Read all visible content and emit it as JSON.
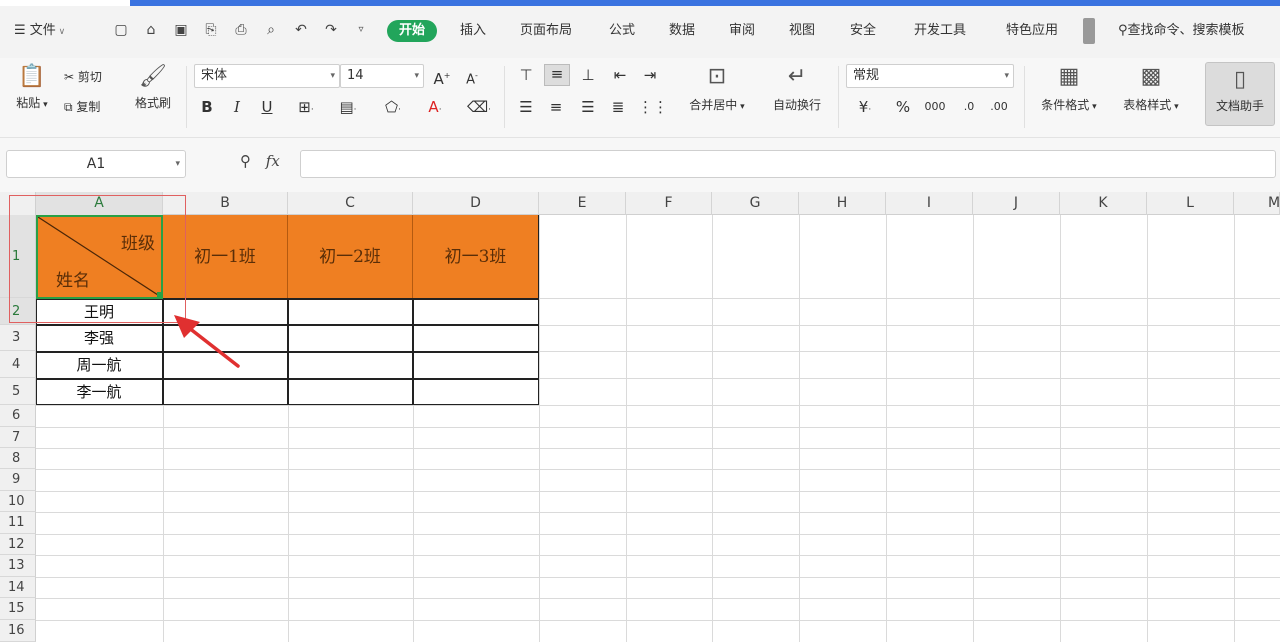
{
  "menubar": {
    "file_label": "文件",
    "tabs": [
      "开始",
      "插入",
      "页面布局",
      "公式",
      "数据",
      "审阅",
      "视图",
      "安全",
      "开发工具",
      "特色应用"
    ],
    "active_tab": "开始",
    "search_label": "查找命令、搜索模板"
  },
  "ribbon": {
    "paste": "粘贴",
    "cut": "剪切",
    "copy": "复制",
    "format_painter": "格式刷",
    "font_name": "宋体",
    "font_size": "14",
    "merge_center": "合并居中",
    "wrap_text": "自动换行",
    "number_format": "常规",
    "conditional_format": "条件格式",
    "table_style": "表格样式",
    "doc_helper": "文档助手"
  },
  "formula_bar": {
    "name_box": "A1",
    "fx_label": "fx",
    "formula": ""
  },
  "sheet": {
    "columns": [
      "A",
      "B",
      "C",
      "D",
      "E",
      "F",
      "G",
      "H",
      "I",
      "J",
      "K",
      "L",
      "M"
    ],
    "rows": [
      "1",
      "2",
      "3",
      "4",
      "5",
      "6",
      "7",
      "8",
      "9",
      "10",
      "11",
      "12",
      "13",
      "14",
      "15",
      "16"
    ],
    "header_diag_top": "班级",
    "header_diag_bottom": "姓名",
    "class_headers": [
      "初一1班",
      "初一2班",
      "初一3班"
    ],
    "names": [
      "王明",
      "李强",
      "周一航",
      "李一航"
    ],
    "colors": {
      "header_fill": "#ef7f22",
      "selection": "#29a046",
      "active_tab": "#22a55b"
    }
  }
}
